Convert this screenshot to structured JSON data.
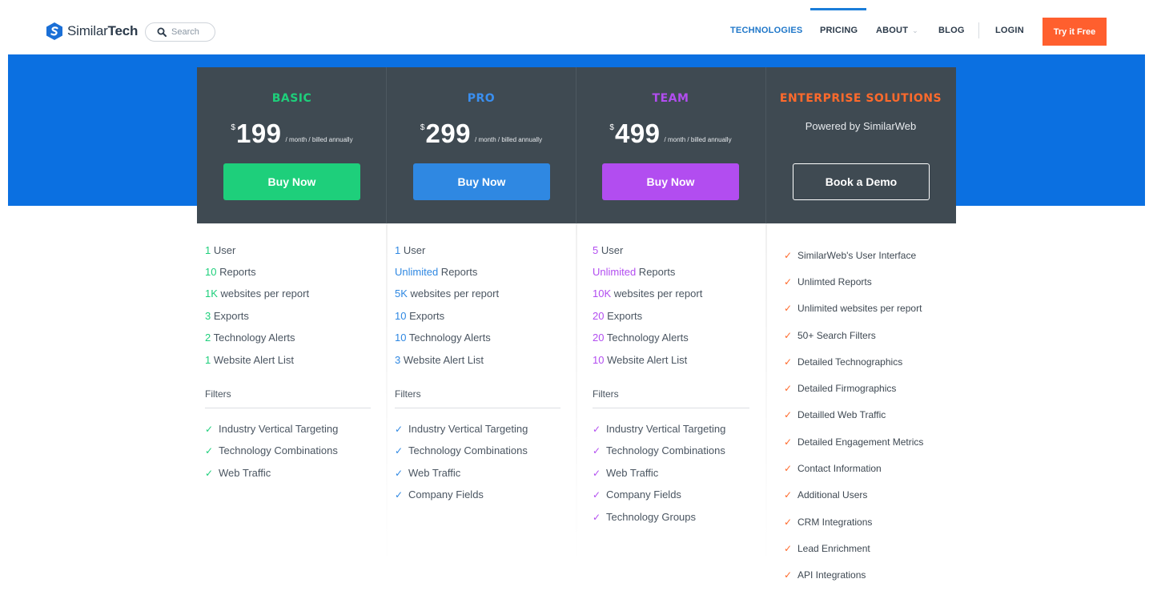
{
  "header": {
    "brand_light": "Similar",
    "brand_bold": "Tech",
    "search_label": "Search",
    "nav": {
      "technologies": "TECHNOLOGIES",
      "pricing": "PRICING",
      "about": "ABOUT",
      "blog": "BLOG",
      "login": "LOGIN"
    },
    "try_label": "Try it Free"
  },
  "colors": {
    "hero": "#0b70e1",
    "card": "#3f4a52",
    "basic": "#1ecf7b",
    "pro": "#2f88e2",
    "team": "#b24df0",
    "enterprise": "#ff6a2c"
  },
  "plans": [
    {
      "name": "BASIC",
      "currency": "$",
      "price": "199",
      "period": "/ month / billed annually",
      "button": "Buy Now",
      "features": [
        {
          "value": "1",
          "label": " User"
        },
        {
          "value": "10",
          "label": " Reports"
        },
        {
          "value": "1K",
          "label": " websites per report"
        },
        {
          "value": "3",
          "label": " Exports"
        },
        {
          "value": "2",
          "label": " Technology Alerts"
        },
        {
          "value": "1",
          "label": " Website Alert List"
        }
      ],
      "filters_label": "Filters",
      "filters": [
        "Industry Vertical Targeting",
        "Technology Combinations",
        "Web Traffic"
      ]
    },
    {
      "name": "PRO",
      "currency": "$",
      "price": "299",
      "period": "/ month / billed annually",
      "button": "Buy Now",
      "features": [
        {
          "value": "1",
          "label": " User"
        },
        {
          "value": "Unlimited",
          "label": " Reports"
        },
        {
          "value": "5K",
          "label": " websites per report"
        },
        {
          "value": "10",
          "label": " Exports"
        },
        {
          "value": "10",
          "label": " Technology Alerts"
        },
        {
          "value": "3",
          "label": " Website Alert List"
        }
      ],
      "filters_label": "Filters",
      "filters": [
        "Industry Vertical Targeting",
        "Technology Combinations",
        "Web Traffic",
        "Company Fields"
      ]
    },
    {
      "name": "TEAM",
      "currency": "$",
      "price": "499",
      "period": "/ month / billed annually",
      "button": "Buy Now",
      "features": [
        {
          "value": "5",
          "label": " User"
        },
        {
          "value": "Unlimited",
          "label": " Reports"
        },
        {
          "value": "10K",
          "label": " websites per report"
        },
        {
          "value": "20",
          "label": " Exports"
        },
        {
          "value": "20",
          "label": " Technology Alerts"
        },
        {
          "value": "10",
          "label": " Website Alert List"
        }
      ],
      "filters_label": "Filters",
      "filters": [
        "Industry Vertical Targeting",
        "Technology Combinations",
        "Web Traffic",
        "Company Fields",
        "Technology Groups"
      ]
    }
  ],
  "enterprise": {
    "name": "ENTERPRISE SOLUTIONS",
    "subtitle": "Powered by SimilarWeb",
    "button": "Book a Demo",
    "features": [
      "SimilarWeb's User Interface",
      "Unlimted Reports",
      "Unlimited websites per report",
      "50+ Search Filters",
      "Detailed Technographics",
      "Detailed Firmographics",
      "Detailled Web Traffic",
      "Detailed Engagement Metrics",
      "Contact Information",
      "Additional Users",
      "CRM Integrations",
      "Lead Enrichment",
      "API Integrations"
    ]
  },
  "icons": {
    "logo": "similartech-logo-icon",
    "search": "search-icon",
    "check": "check-icon",
    "caret": "chevron-down-icon"
  }
}
